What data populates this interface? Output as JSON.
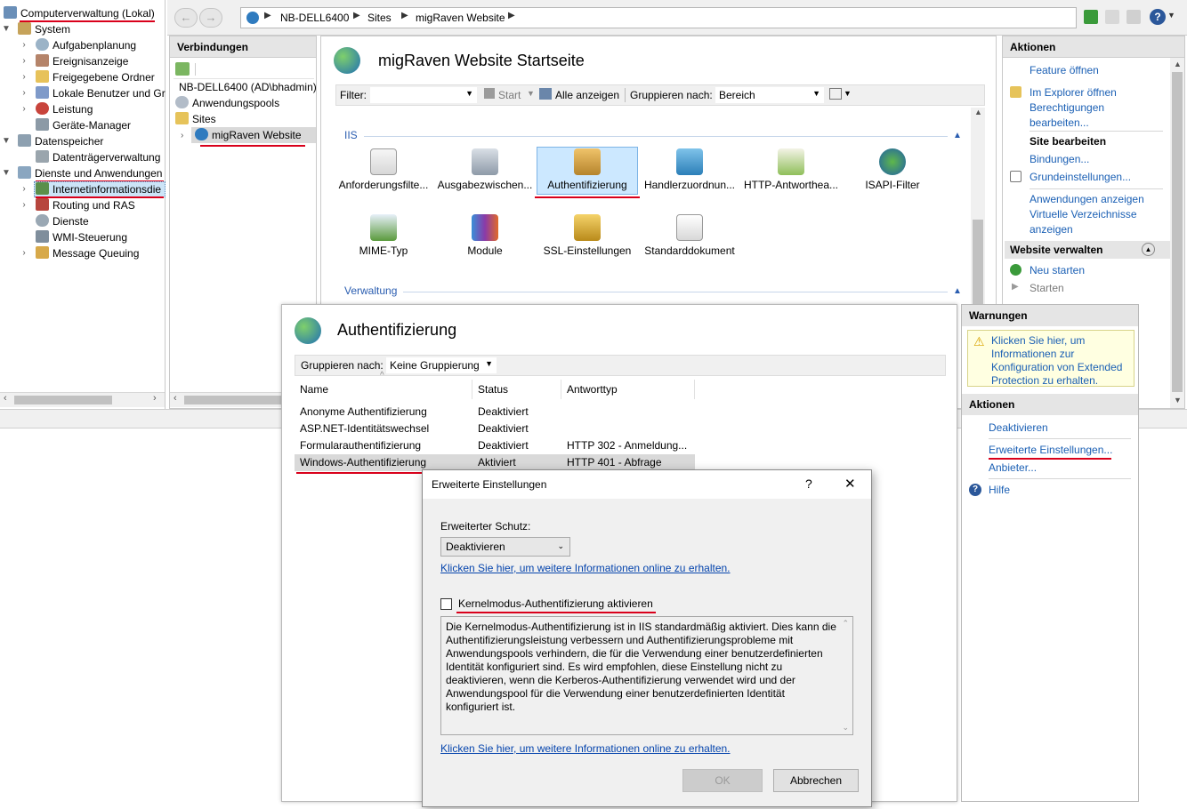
{
  "colors": {
    "accent": "#1a5fb4",
    "underline": "#d9001b",
    "selection": "#cce4f7",
    "warning_bg": "#ffffe1"
  },
  "tree": {
    "root": "Computerverwaltung (Lokal)",
    "items": [
      {
        "label": "System",
        "level": 1,
        "icon": "tools-icon"
      },
      {
        "label": "Aufgabenplanung",
        "level": 2,
        "icon": "clock-icon"
      },
      {
        "label": "Ereignisanzeige",
        "level": 2,
        "icon": "event-viewer-icon"
      },
      {
        "label": "Freigegebene Ordner",
        "level": 2,
        "icon": "shared-folder-icon"
      },
      {
        "label": "Lokale Benutzer und Gr",
        "level": 2,
        "icon": "users-icon"
      },
      {
        "label": "Leistung",
        "level": 2,
        "icon": "performance-icon"
      },
      {
        "label": "Geräte-Manager",
        "level": 2,
        "icon": "device-manager-icon"
      },
      {
        "label": "Datenspeicher",
        "level": 1,
        "icon": "storage-icon"
      },
      {
        "label": "Datenträgerverwaltung",
        "level": 2,
        "icon": "disk-icon"
      },
      {
        "label": "Dienste und Anwendungen",
        "level": 1,
        "icon": "services-apps-icon"
      },
      {
        "label": "Internetinformationsdie",
        "level": 2,
        "icon": "iis-icon"
      },
      {
        "label": "Routing und RAS",
        "level": 2,
        "icon": "routing-icon"
      },
      {
        "label": "Dienste",
        "level": 2,
        "icon": "gear-icon"
      },
      {
        "label": "WMI-Steuerung",
        "level": 2,
        "icon": "wmi-icon"
      },
      {
        "label": "Message Queuing",
        "level": 2,
        "icon": "message-queue-icon"
      }
    ]
  },
  "breadcrumb": [
    "NB-DELL6400",
    "Sites",
    "migRaven Website"
  ],
  "connections": {
    "title": "Verbindungen",
    "server": "NB-DELL6400 (AD\\bhadmin)",
    "app_pools": "Anwendungspools",
    "sites": "Sites",
    "site": "migRaven Website"
  },
  "main": {
    "title": "migRaven Website Startseite",
    "filter_label": "Filter:",
    "start_label": "Start",
    "show_all_label": "Alle anzeigen",
    "group_by_label": "Gruppieren nach:",
    "group_by_value": "Bereich",
    "group_iis": "IIS",
    "group_admin": "Verwaltung",
    "features": [
      "Anforderungsfilte...",
      "Ausgabezwischen...",
      "Authentifizierung",
      "Handlerzuordnun...",
      "HTTP-Antworthea...",
      "ISAPI-Filter",
      "MIME-Typ",
      "Module",
      "SSL-Einstellungen",
      "Standarddokument"
    ]
  },
  "actions": {
    "title": "Aktionen",
    "open_feature": "Feature öffnen",
    "open_explorer": "Im Explorer öffnen",
    "edit_permissions": "Berechtigungen bearbeiten...",
    "site_edit_head": "Site bearbeiten",
    "bindings": "Bindungen...",
    "basic_settings": "Grundeinstellungen...",
    "view_apps": "Anwendungen anzeigen",
    "view_vdirs": "Virtuelle Verzeichnisse anzeigen",
    "manage_site_head": "Website verwalten",
    "restart": "Neu starten",
    "start": "Starten"
  },
  "auth": {
    "title": "Authentifizierung",
    "group_by_label": "Gruppieren nach:",
    "group_by_value": "Keine Gruppierung",
    "columns": [
      "Name",
      "Status",
      "Antworttyp"
    ],
    "rows": [
      {
        "name": "Anonyme Authentifizierung",
        "status": "Deaktiviert",
        "type": ""
      },
      {
        "name": "ASP.NET-Identitätswechsel",
        "status": "Deaktiviert",
        "type": ""
      },
      {
        "name": "Formularauthentifizierung",
        "status": "Deaktiviert",
        "type": "HTTP 302 - Anmeldung..."
      },
      {
        "name": "Windows-Authentifizierung",
        "status": "Aktiviert",
        "type": "HTTP 401 - Abfrage"
      }
    ]
  },
  "auth_actions": {
    "warnings_head": "Warnungen",
    "warning_text": "Klicken Sie hier, um Informationen zur Konfiguration von Extended Protection zu erhalten.",
    "actions_head": "Aktionen",
    "deactivate": "Deaktivieren",
    "advanced": "Erweiterte Einstellungen...",
    "providers": "Anbieter...",
    "help": "Hilfe"
  },
  "dialog": {
    "title": "Erweiterte Einstellungen",
    "help_glyph": "?",
    "close_glyph": "✕",
    "ext_protection_label": "Erweiterter Schutz:",
    "ext_protection_value": "Deaktivieren",
    "info_link": "Klicken Sie hier, um weitere Informationen online zu erhalten.",
    "kernel_checkbox": "Kernelmodus-Authentifizierung aktivieren",
    "kernel_description": "Die Kernelmodus-Authentifizierung ist in IIS standardmäßig aktiviert. Dies kann die Authentifizierungsleistung verbessern und Authentifizierungsprobleme mit Anwendungspools verhindern, die für die Verwendung einer benutzerdefinierten Identität konfiguriert sind. Es wird empfohlen, diese Einstellung nicht zu deaktivieren, wenn die Kerberos-Authentifizierung verwendet wird und der Anwendungspool für die Verwendung einer benutzerdefinierten Identität konfiguriert ist.",
    "info_link_2": "Klicken Sie hier, um weitere Informationen online zu erhalten.",
    "ok": "OK",
    "cancel": "Abbrechen"
  }
}
